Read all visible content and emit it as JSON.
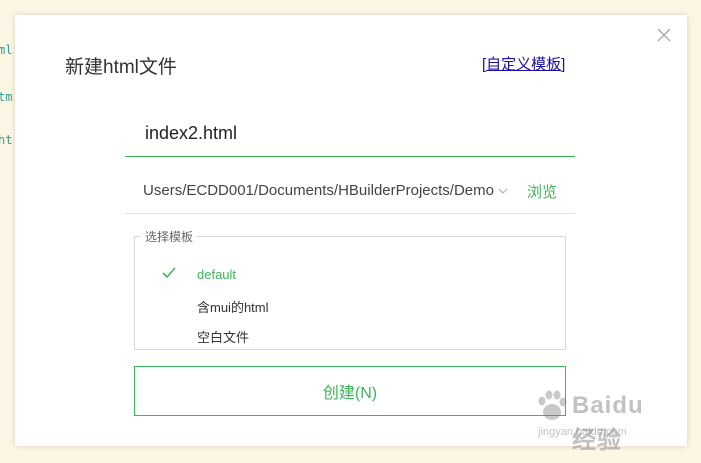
{
  "editor_bg": {
    "lines": [
      "ml",
      "tm",
      "ht"
    ]
  },
  "dialog": {
    "title": "新建html文件",
    "custom_template_link": "[自定义模板]",
    "filename_value": "index2.html",
    "path_value": "Users/ECDD001/Documents/HBuilderProjects/Demo",
    "browse_label": "浏览",
    "template_group_label": "选择模板",
    "templates": [
      {
        "label": "default",
        "selected": true
      },
      {
        "label": "含mui的html",
        "selected": false
      },
      {
        "label": "空白文件",
        "selected": false
      }
    ],
    "create_button": "创建(N)"
  },
  "watermark": {
    "text": "Baidu经验",
    "url": "jingyan.baidu.com"
  },
  "colors": {
    "accent": "#3cb65a",
    "background": "#fdf6e3",
    "link": "#1a0dab"
  }
}
